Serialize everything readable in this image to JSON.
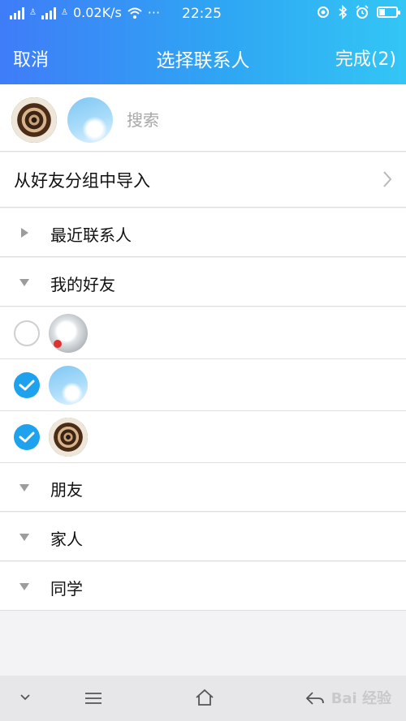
{
  "status_bar": {
    "speed": "0.02K/s",
    "time": "22:25",
    "dots": "···"
  },
  "header": {
    "cancel_label": "取消",
    "title": "选择联系人",
    "done_label": "完成(2)"
  },
  "search": {
    "placeholder": "搜索",
    "selected_avatars": [
      "coffee-avatar",
      "sky-avatar"
    ]
  },
  "import": {
    "label": "从好友分组中导入"
  },
  "groups": [
    {
      "label": "最近联系人",
      "expanded": false
    },
    {
      "label": "我的好友",
      "expanded": true
    },
    {
      "label": "朋友",
      "expanded": false
    },
    {
      "label": "家人",
      "expanded": false
    },
    {
      "label": "同学",
      "expanded": false
    }
  ],
  "friends": [
    {
      "name": "",
      "checked": false,
      "avatar": "cat-avatar"
    },
    {
      "name": "",
      "checked": true,
      "avatar": "sky-avatar"
    },
    {
      "name": "",
      "checked": true,
      "avatar": "coffee-avatar"
    }
  ],
  "watermark": "Bai 经验",
  "colors": {
    "header_start": "#3f7cf8",
    "header_end": "#33c6f5",
    "check_on": "#1ea2ee"
  }
}
